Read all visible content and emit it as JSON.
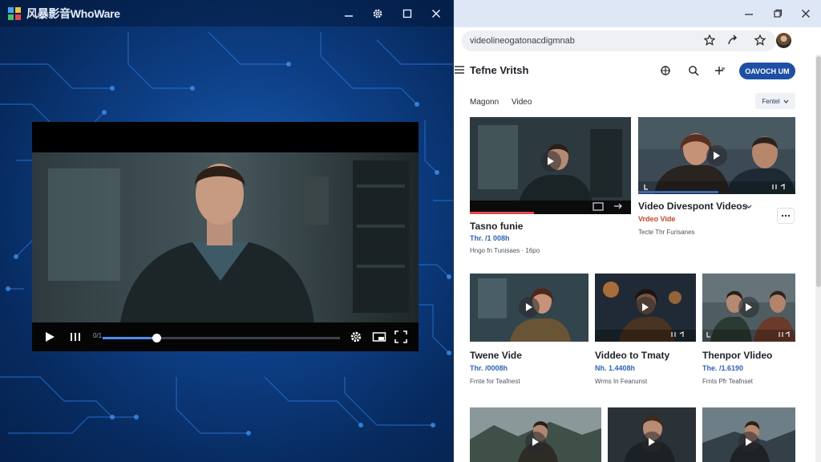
{
  "player": {
    "app_title": "风暴影音WhoWare",
    "progress_fraction": 0.225,
    "time_label": "0/1"
  },
  "browser": {
    "address": "videolineogatonacdigmnab",
    "site_title": "Tefne Vritsh",
    "upload_label": "OAVOCH UM",
    "filters": [
      "Magonn",
      "Video"
    ],
    "sort_label": "Fentel",
    "featured": [
      {
        "title": "Tasno funie",
        "views": "Thr. /1 008h",
        "meta": "Hngo fn Tunisaes · 16po"
      },
      {
        "title": "Video Divespont Videos",
        "subtitle": "Vrdeo Vide",
        "meta": "Tecte Thr Furisanes"
      }
    ],
    "grid_row1": [
      {
        "title": "Twene Vide",
        "views": "Thr. /0008h",
        "meta": "Frnte for Teafnest"
      },
      {
        "title": "Viddeo to Tmaty",
        "views": "Nh. 1.4408h",
        "meta": "Wrms In Feanunst"
      },
      {
        "title": "Thenpor Vlideo",
        "views": "The. /1.6190",
        "meta": "Frnts Pfr Teafnset"
      }
    ]
  },
  "colors": {
    "accent": "#1d4fa6",
    "views_blue": "#2d63c8",
    "subtitle_red": "#d9432a",
    "player_bg": "#0d3f86"
  }
}
